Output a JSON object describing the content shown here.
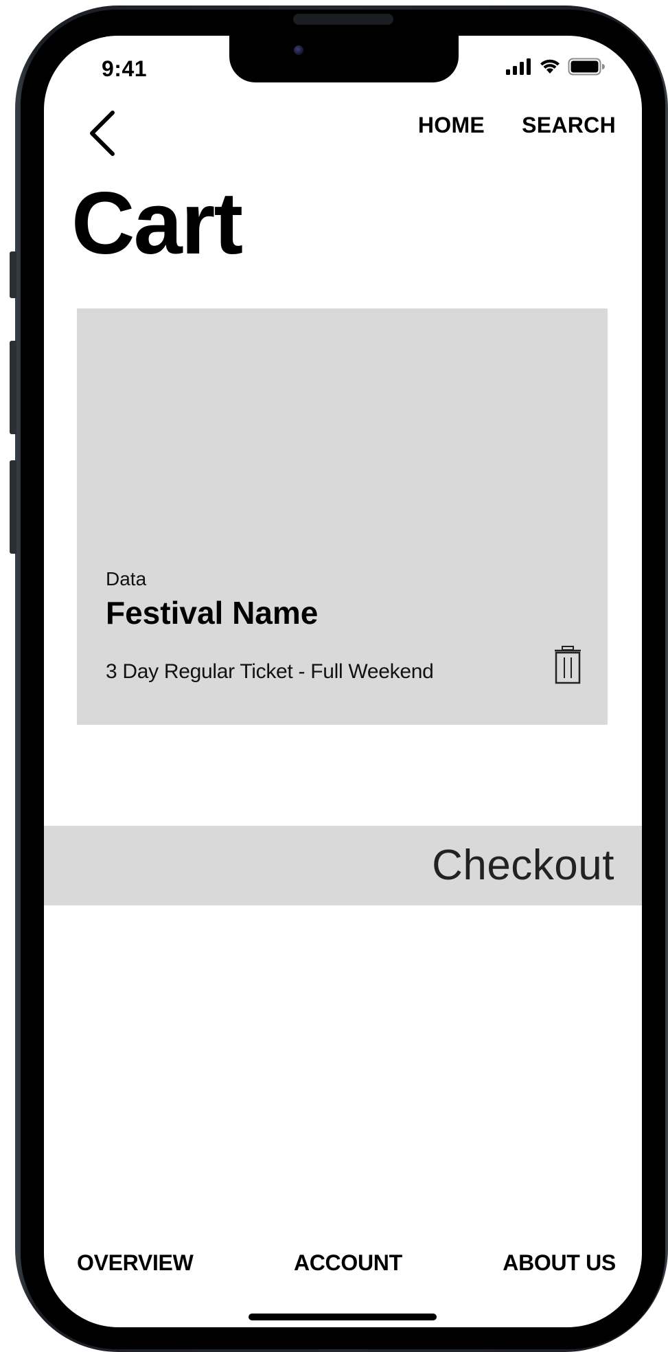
{
  "status_bar": {
    "time": "9:41",
    "icons": [
      "signal-icon",
      "wifi-icon",
      "battery-icon"
    ]
  },
  "nav": {
    "back_icon": "chevron-left-icon",
    "links": [
      "HOME",
      "SEARCH"
    ]
  },
  "page": {
    "title": "Cart"
  },
  "cart": {
    "items": [
      {
        "overline": "Data",
        "title": "Festival Name",
        "description": "3 Day Regular Ticket - Full Weekend",
        "delete_icon": "trash-icon"
      }
    ]
  },
  "checkout": {
    "label": "Checkout"
  },
  "bottom_nav": {
    "items": [
      "OVERVIEW",
      "ACCOUNT",
      "ABOUT US"
    ]
  },
  "colors": {
    "card_bg": "#d9d9d9",
    "text": "#000000",
    "frame": "#1c2026"
  }
}
